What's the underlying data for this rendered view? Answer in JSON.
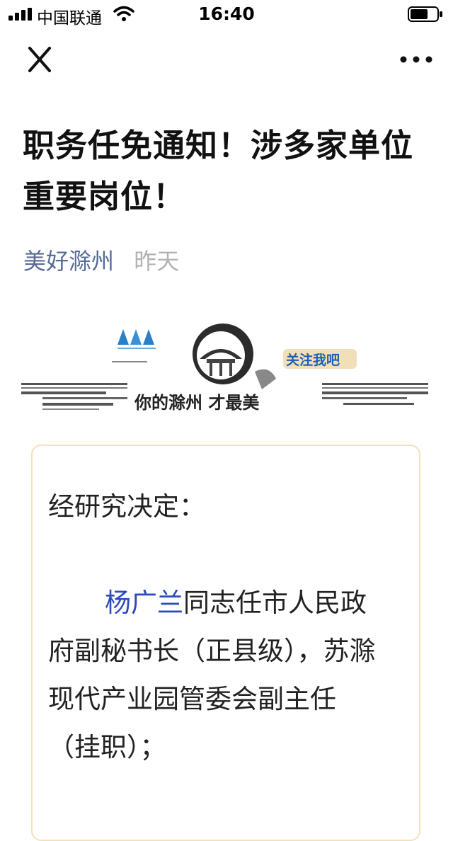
{
  "status_bar": {
    "carrier": "中国联通",
    "time": "16:40"
  },
  "article": {
    "title": "职务任免通知！涉多家单位重要岗位！",
    "author": "美好滁州",
    "date": "昨天"
  },
  "banner": {
    "slogan": "你的滁州 才最美",
    "follow_tag": "关注我吧"
  },
  "card": {
    "intro": "经研究决定：",
    "name": "杨广兰",
    "body": "同志任市人民政府副秘书长（正县级），苏滁现代产业园管委会副主任（挂职）；"
  }
}
